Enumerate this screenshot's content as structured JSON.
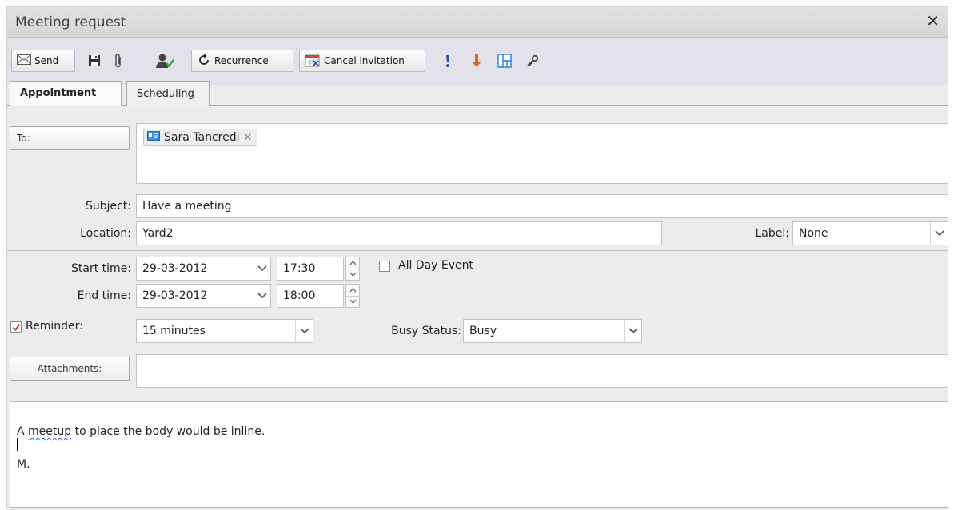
{
  "window": {
    "title": "Meeting request",
    "close_glyph": "✕"
  },
  "toolbar": {
    "send_label": "Send",
    "recurrence_label": "Recurrence",
    "cancel_invitation_label": "Cancel invitation",
    "icons": [
      "save-icon",
      "attach-icon",
      "check-names-icon",
      "high-importance-icon",
      "low-importance-icon",
      "layout-icon",
      "key-icon"
    ]
  },
  "tabs": [
    {
      "label": "Appointment",
      "active": true
    },
    {
      "label": "Scheduling",
      "active": false
    }
  ],
  "form": {
    "to_label": "To:",
    "recipients": [
      {
        "name": "Sara Tancredi"
      }
    ],
    "subject_label": "Subject:",
    "subject_value": "Have a meeting",
    "location_label": "Location:",
    "location_value": "Yard2",
    "label_label": "Label:",
    "label_value": "None",
    "start_time_label": "Start time:",
    "start_date": "29-03-2012",
    "start_time": "17:30",
    "all_day_label": "All Day Event",
    "all_day_checked": false,
    "end_time_label": "End time:",
    "end_date": "29-03-2012",
    "end_time": "18:00",
    "reminder_label": "Reminder:",
    "reminder_checked": true,
    "reminder_value": "15 minutes",
    "busy_status_label": "Busy Status:",
    "busy_status_value": "Busy",
    "attachments_label": "Attachments:"
  },
  "body": {
    "line1_misspelled": "meetup",
    "line1_prefix": "A ",
    "line1_suffix": " to place the body would be inline.",
    "line3": "M."
  },
  "colors": {
    "checkbox_check": "#c0392b",
    "high_importance": "#1b4fd6",
    "low_importance": "#e0661b",
    "spell_underline": "#3d5bd9"
  }
}
